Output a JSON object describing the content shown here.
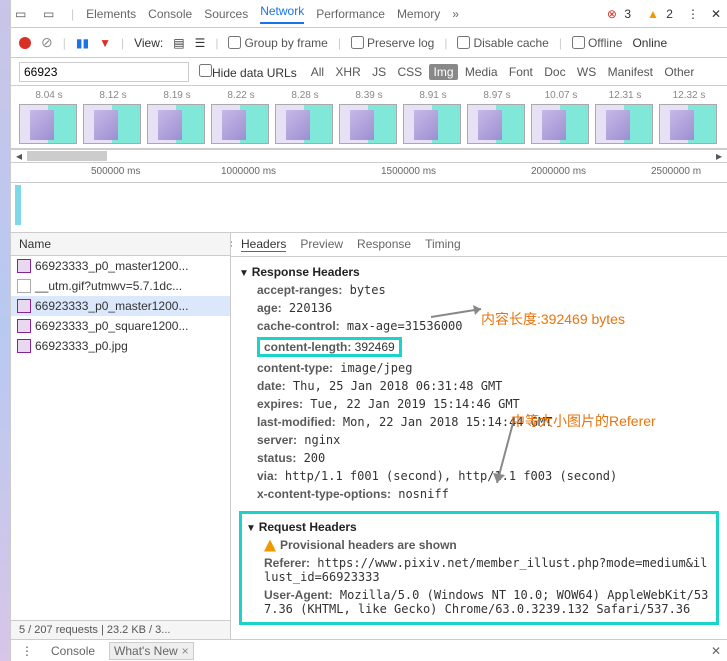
{
  "devtools": {
    "tabs": [
      "Elements",
      "Console",
      "Sources",
      "Network",
      "Performance",
      "Memory"
    ],
    "activeTab": "Network",
    "overflow": "»",
    "errors": "3",
    "warnings": "2"
  },
  "toolbar": {
    "viewLabel": "View:",
    "groupByFrame": "Group by frame",
    "preserveLog": "Preserve log",
    "disableCache": "Disable cache",
    "offline": "Offline",
    "online": "Online"
  },
  "filter": {
    "value": "66923",
    "hideDataUrls": "Hide data URLs",
    "types": [
      "All",
      "XHR",
      "JS",
      "CSS",
      "Img",
      "Media",
      "Font",
      "Doc",
      "WS",
      "Manifest",
      "Other"
    ],
    "activeType": "Img"
  },
  "filmstrip": [
    "8.04 s",
    "8.12 s",
    "8.19 s",
    "8.22 s",
    "8.28 s",
    "8.39 s",
    "8.91 s",
    "8.97 s",
    "10.07 s",
    "12.31 s",
    "12.32 s"
  ],
  "ruler": [
    "500000 ms",
    "1000000 ms",
    "1500000 ms",
    "2000000 ms",
    "2500000 m"
  ],
  "requests": {
    "header": "Name",
    "items": [
      "66923333_p0_master1200...",
      "__utm.gif?utmwv=5.7.1dc...",
      "66923333_p0_master1200...",
      "66923333_p0_square1200...",
      "66923333_p0.jpg"
    ],
    "selectedIndex": 2
  },
  "detailTabs": [
    "Headers",
    "Preview",
    "Response",
    "Timing"
  ],
  "detailActive": "Headers",
  "response": {
    "title": "Response Headers",
    "rows": [
      {
        "k": "accept-ranges",
        "v": "bytes"
      },
      {
        "k": "age",
        "v": "220136"
      },
      {
        "k": "cache-control",
        "v": "max-age=31536000"
      },
      {
        "k": "content-length",
        "v": "392469",
        "hl": true
      },
      {
        "k": "content-type",
        "v": "image/jpeg"
      },
      {
        "k": "date",
        "v": "Thu, 25 Jan 2018 06:31:48 GMT"
      },
      {
        "k": "expires",
        "v": "Tue, 22 Jan 2019 15:14:46 GMT"
      },
      {
        "k": "last-modified",
        "v": "Mon, 22 Jan 2018 15:14:44 GMT"
      },
      {
        "k": "server",
        "v": "nginx"
      },
      {
        "k": "status",
        "v": "200"
      },
      {
        "k": "via",
        "v": "http/1.1 f001 (second), http/1.1 f003 (second)"
      },
      {
        "k": "x-content-type-options",
        "v": "nosniff"
      }
    ]
  },
  "request": {
    "title": "Request Headers",
    "provisional": "Provisional headers are shown",
    "rows": [
      {
        "k": "Referer",
        "v": "https://www.pixiv.net/member_illust.php?mode=medium&illust_id=66923333"
      },
      {
        "k": "User-Agent",
        "v": "Mozilla/5.0 (Windows NT 10.0; WOW64) AppleWebKit/537.36 (KHTML, like Gecko) Chrome/63.0.3239.132 Safari/537.36"
      }
    ]
  },
  "annotations": {
    "a1": "内容长度:392469 bytes",
    "a2": "中等大小图片的Referer"
  },
  "status": "5 / 207 requests  |  23.2 KB / 3...",
  "drawer": {
    "console": "Console",
    "whatsnew": "What's New"
  }
}
